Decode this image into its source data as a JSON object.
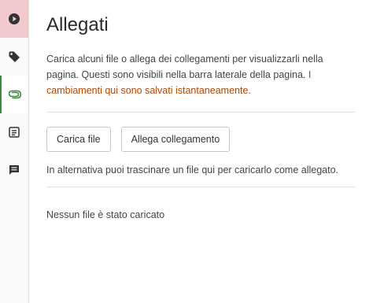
{
  "rail": {
    "items": [
      {
        "icon": "play-circle-icon",
        "color": "#333333"
      },
      {
        "icon": "tag-icon",
        "color": "#333333"
      },
      {
        "icon": "paperclip-icon",
        "color": "#3a8a3a",
        "active": true
      },
      {
        "icon": "form-icon",
        "color": "#333333"
      },
      {
        "icon": "comment-icon",
        "color": "#333333"
      }
    ]
  },
  "panel": {
    "title": "Allegati",
    "description": "Carica alcuni file o allega dei collegamenti per visualizzarli nella pagina. Questi sono visibili nella barra laterale della pagina.",
    "warning": "I cambiamenti qui sono salvati istantaneamente.",
    "upload_label": "Carica file",
    "link_label": "Allega collegamento",
    "drag_hint": "In alternativa puoi trascinare un file qui per caricarlo come allegato.",
    "empty_text": "Nessun file è stato caricato"
  },
  "colors": {
    "warning": "#b34700",
    "active_accent": "#3a8a3a",
    "play_bg": "#f2c9cc"
  }
}
